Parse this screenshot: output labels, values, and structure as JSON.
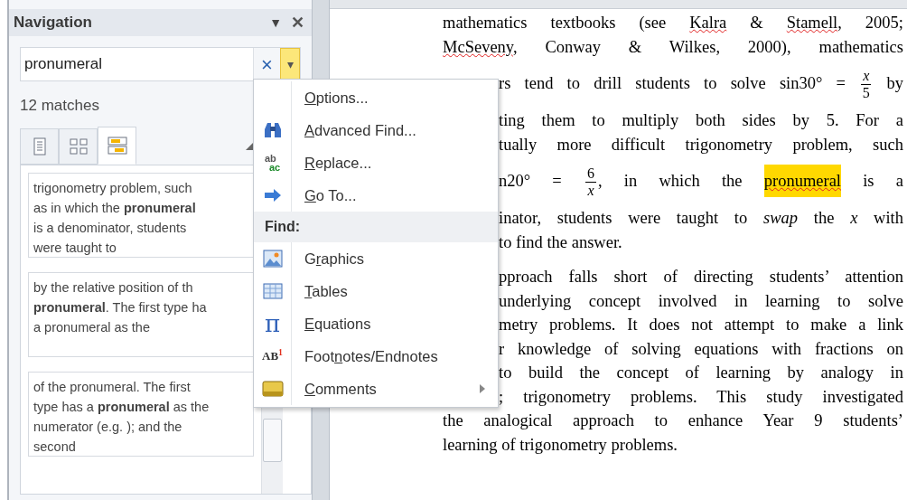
{
  "navigation": {
    "title": "Navigation",
    "menu_glyph": "▼",
    "close_glyph": "✕",
    "search": {
      "value": "pronumeral",
      "clear_glyph": "×",
      "dropdown_glyph": "▾",
      "dropdown_open": true
    },
    "match_count": "12 matches",
    "tabs": [
      {
        "selected": false
      },
      {
        "selected": false
      },
      {
        "selected": true
      }
    ],
    "results": [
      {
        "lines": [
          "trigonometry problem, such",
          "as  in which the **pronumeral**",
          "is a denominator, students",
          "were taught to"
        ]
      },
      {
        "lines": [
          "by the relative position of th",
          "**pronumeral**. The first type ha",
          "a pronumeral as the"
        ]
      },
      {
        "lines": [
          "of the pronumeral. The first",
          "type has a **pronumeral** as the",
          "numerator (e.g. ); and the",
          "second"
        ]
      }
    ]
  },
  "menu": {
    "items": [
      {
        "kind": "item",
        "key": "O",
        "after": "ptions...",
        "submenu": false
      },
      {
        "kind": "item",
        "key": "A",
        "after": "dvanced Find...",
        "submenu": false
      },
      {
        "kind": "item",
        "key": "R",
        "after": "eplace...",
        "submenu": false,
        "icon_glyph": "ab",
        "icon_glyph_2": "ac"
      },
      {
        "kind": "item",
        "key": "G",
        "after": "o To...",
        "submenu": false
      },
      {
        "kind": "header",
        "label": "Find:"
      },
      {
        "kind": "item",
        "before": "G",
        "key": "r",
        "after": "aphics",
        "submenu": false
      },
      {
        "kind": "item",
        "key": "T",
        "after": "ables",
        "submenu": false
      },
      {
        "kind": "item",
        "key": "E",
        "after": "quations",
        "submenu": false,
        "icon_glyph": "π"
      },
      {
        "kind": "item",
        "before": "Foot",
        "key": "n",
        "after": "otes/Endnotes",
        "submenu": false,
        "icon_glyph": "AB",
        "icon_glyph_2": "1"
      },
      {
        "kind": "item",
        "key": "C",
        "after": "omments",
        "submenu": true
      }
    ]
  },
  "document": {
    "paragraphs": [
      {
        "lines": [
          {
            "covered": false,
            "parts": [
              {
                "kind": "text",
                "text": "mathematics textbooks (see ",
                "spelling": false,
                "highlight": false
              },
              {
                "kind": "text",
                "text": "Kalra",
                "spelling": true,
                "highlight": false
              },
              {
                "kind": "text",
                "text": " & ",
                "spelling": false,
                "highlight": false
              },
              {
                "kind": "text",
                "text": "Stamell",
                "spelling": true,
                "highlight": false
              },
              {
                "kind": "text",
                "text": ", 2005;",
                "spelling": false,
                "highlight": false
              }
            ]
          },
          {
            "covered": false,
            "parts": [
              {
                "kind": "text",
                "text": "McSeveny",
                "spelling": true,
                "highlight": false
              },
              {
                "kind": "text",
                "text": ", Conway & Wilkes, 2000), mathematics",
                "spelling": false,
                "highlight": false
              }
            ]
          },
          {
            "covered": true,
            "parts": [
              {
                "kind": "text",
                "text": "rs tend to drill students to solve sin30° = ",
                "spelling": false,
                "highlight": false
              },
              {
                "kind": "fraction",
                "numerator": "*x*",
                "denominator": "5"
              },
              {
                "kind": "text",
                "text": " by",
                "spelling": false,
                "highlight": false
              }
            ]
          },
          {
            "covered": true,
            "parts": [
              {
                "kind": "text",
                "text": "ting them to multiply both sides by 5. For a",
                "spelling": false,
                "highlight": false
              }
            ]
          },
          {
            "covered": true,
            "parts": [
              {
                "kind": "text",
                "text": "tually more difficult trigonometry problem, such",
                "spelling": false,
                "highlight": false
              }
            ]
          },
          {
            "covered": true,
            "parts": [
              {
                "kind": "text",
                "text": "n20° = ",
                "spelling": false,
                "highlight": false
              },
              {
                "kind": "fraction",
                "numerator": "6",
                "denominator": "*x*"
              },
              {
                "kind": "text",
                "text": ",  in which the ",
                "spelling": false,
                "highlight": false
              },
              {
                "kind": "text",
                "text": "pronumeral",
                "spelling": true,
                "highlight": true
              },
              {
                "kind": "text",
                "text": " is a",
                "spelling": false,
                "highlight": false
              }
            ]
          },
          {
            "covered": true,
            "parts": [
              {
                "kind": "text",
                "text": "inator, students were taught to *swap* the *x* with",
                "spelling": false,
                "highlight": false
              }
            ]
          },
          {
            "covered": true,
            "last": true,
            "parts": [
              {
                "kind": "text",
                "text": "to find the answer.",
                "spelling": false,
                "highlight": false
              }
            ]
          }
        ]
      },
      {
        "lines": [
          {
            "covered": true,
            "parts": [
              {
                "kind": "text",
                "text": "pproach falls short of directing students’ attention",
                "spelling": false,
                "highlight": false
              }
            ]
          },
          {
            "covered": true,
            "parts": [
              {
                "kind": "text",
                "text": "underlying concept involved in learning to solve",
                "spelling": false,
                "highlight": false
              }
            ]
          },
          {
            "covered": true,
            "parts": [
              {
                "kind": "text",
                "text": "metry problems. It does not attempt to make a link",
                "spelling": false,
                "highlight": false
              }
            ]
          },
          {
            "covered": true,
            "parts": [
              {
                "kind": "text",
                "text": "r knowledge of solving equations with fractions on",
                "spelling": false,
                "highlight": false
              }
            ]
          },
          {
            "covered": true,
            "parts": [
              {
                "kind": "text",
                "text": "to build the concept of learning by analogy in",
                "spelling": false,
                "highlight": false
              }
            ]
          },
          {
            "covered": true,
            "parts": [
              {
                "kind": "text",
                "text": "; trigonometry problems. This study investigated",
                "spelling": false,
                "highlight": false
              }
            ]
          },
          {
            "covered": false,
            "parts": [
              {
                "kind": "text",
                "text": "the analogical approach to enhance Year 9 students’",
                "spelling": false,
                "highlight": false
              }
            ]
          },
          {
            "covered": false,
            "last": true,
            "parts": [
              {
                "kind": "text",
                "text": "learning of trigonometry problems.",
                "spelling": false,
                "highlight": false
              }
            ]
          }
        ]
      }
    ]
  }
}
